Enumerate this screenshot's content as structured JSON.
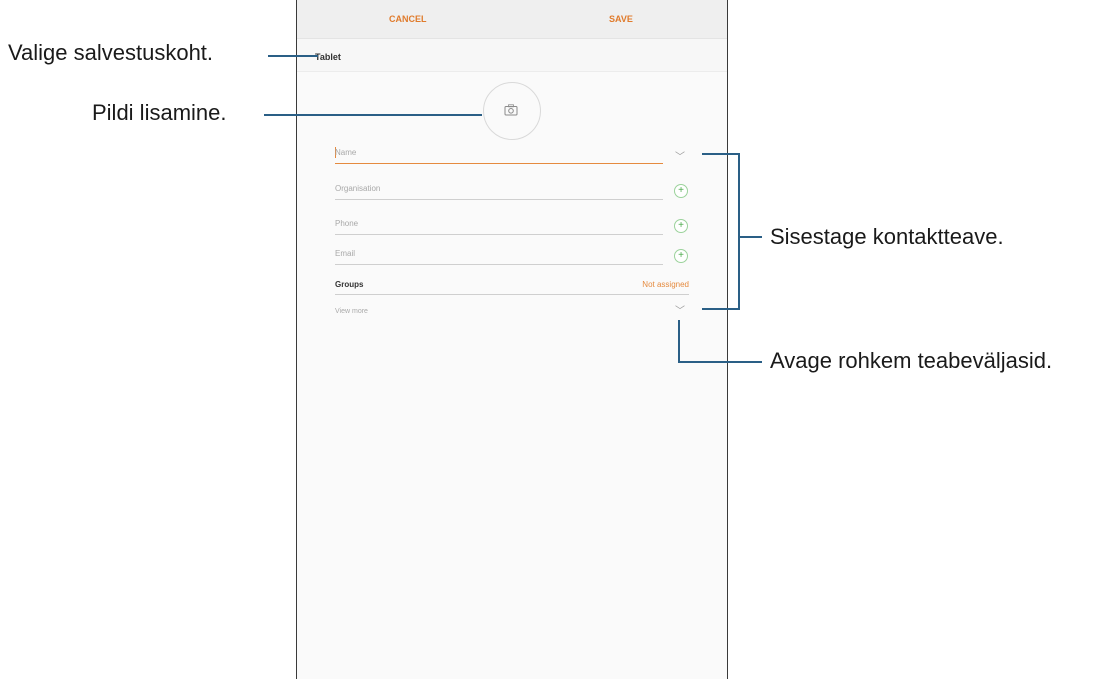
{
  "header": {
    "cancel_label": "CANCEL",
    "save_label": "SAVE"
  },
  "storage": {
    "label": "Tablet"
  },
  "photo": {
    "icon": "camera-icon"
  },
  "fields": {
    "name_placeholder": "Name",
    "organisation_placeholder": "Organisation",
    "phone_placeholder": "Phone",
    "email_placeholder": "Email"
  },
  "groups": {
    "label": "Groups",
    "value": "Not assigned"
  },
  "view_more": {
    "label": "View more"
  },
  "annotations": {
    "storage": "Valige salvestuskoht.",
    "photo": "Pildi lisamine.",
    "contact": "Sisestage kontaktteave.",
    "more": "Avage rohkem teabeväljasid."
  },
  "colors": {
    "accent": "#e58a3e",
    "add_icon": "#4aa94a",
    "callout_line": "#2a5f86"
  }
}
